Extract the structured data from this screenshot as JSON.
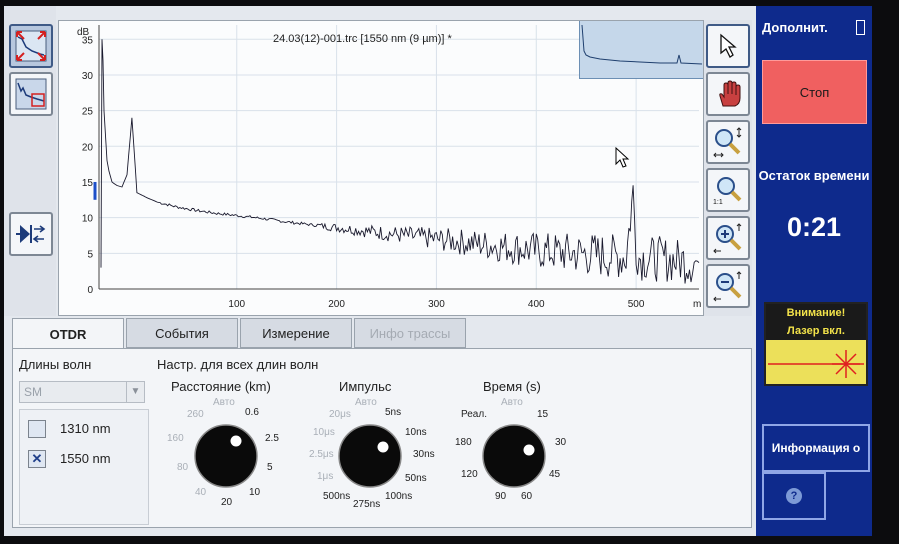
{
  "trace": {
    "title": "24.03(12)-001.trc [1550 nm (9 µm)] *",
    "y_unit": "dB",
    "x_unit": "m",
    "y_ticks": [
      "0",
      "5",
      "10",
      "15",
      "20",
      "25",
      "30",
      "35"
    ],
    "x_ticks": [
      "100",
      "200",
      "300",
      "400",
      "500"
    ]
  },
  "chart_data": {
    "type": "line",
    "title": "24.03(12)-001.trc [1550 nm (9 µm)] *",
    "xlabel": "m",
    "ylabel": "dB",
    "xlim": [
      -38,
      563
    ],
    "ylim": [
      0,
      37
    ],
    "grid": true,
    "x": [
      -36,
      -35,
      -34,
      -33,
      -30,
      -28,
      -25,
      -20,
      -15,
      -10,
      -5,
      0,
      10,
      20,
      40,
      60,
      80,
      100,
      125,
      150,
      175,
      200,
      225,
      250,
      275,
      300,
      325,
      350,
      375,
      400,
      425,
      450,
      475,
      490,
      497,
      500,
      503,
      510,
      525,
      540,
      555,
      563
    ],
    "y": [
      3,
      35,
      32,
      25,
      18,
      16.5,
      15,
      14.5,
      14.3,
      16,
      24,
      13.5,
      12.8,
      12.2,
      11.5,
      11,
      10.6,
      10.3,
      9.9,
      9.4,
      9,
      8.6,
      8.2,
      7.8,
      7.4,
      7,
      6.6,
      6.2,
      5.8,
      5.4,
      5.1,
      4.9,
      4.6,
      4.5,
      13.5,
      6,
      4.4,
      4.3,
      4.2,
      4.0,
      3.8,
      3.7
    ]
  },
  "tabs": [
    {
      "label": "OTDR",
      "active": true
    },
    {
      "label": "События"
    },
    {
      "label": "Измерение"
    },
    {
      "label": "Инфо трассы",
      "disabled": true
    }
  ],
  "settings": {
    "wavelengths_label": "Длины волн",
    "fiber_type": "SM",
    "common_label": "Настр. для всех длин волн",
    "wavelengths": [
      {
        "label": "1310 nm",
        "checked": false,
        "mark": ""
      },
      {
        "label": "1550 nm",
        "checked": true,
        "mark": "✕"
      }
    ],
    "distance": {
      "label": "Расстояние (km)",
      "ticks": [
        "Авто",
        "0.6",
        "2.5",
        "5",
        "10",
        "20",
        "40",
        "80",
        "160",
        "260"
      ]
    },
    "pulse": {
      "label": "Импульс",
      "ticks": [
        "Авто",
        "5ns",
        "10ns",
        "30ns",
        "50ns",
        "100ns",
        "275ns",
        "500ns",
        "1μs",
        "2.5μs",
        "10μs",
        "20μs"
      ]
    },
    "time": {
      "label": "Время (s)",
      "ticks": [
        "Авто",
        "15",
        "30",
        "45",
        "60",
        "90",
        "120",
        "180",
        "Реал."
      ]
    }
  },
  "panel": {
    "title": "Дополнит.",
    "stop_label": "Стоп",
    "remaining_label": "Остаток времени",
    "remaining_time": "0:21",
    "warning_line1": "Внимание!",
    "warning_line2": "Лазер вкл.",
    "info_label": "Информация о",
    "help_label": "?"
  },
  "icons": {
    "left": [
      "full-zoom-icon",
      "trace-overview-icon",
      "connect-fiber-icon"
    ],
    "right": [
      "pointer-icon",
      "hand-icon",
      "zoom-selection-icon",
      "zoom-1-1-icon",
      "zoom-in-icon",
      "zoom-out-icon"
    ]
  },
  "colors": {
    "panel_bg": "#0e2a8c",
    "stop_red": "#f06060",
    "warning_yellow": "#ece05a",
    "laser_red": "#e02020"
  }
}
